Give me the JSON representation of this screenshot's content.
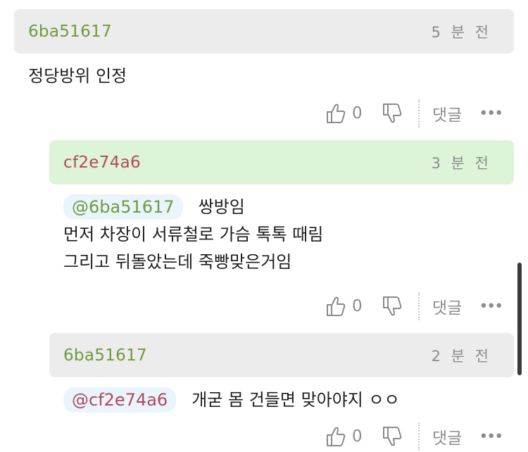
{
  "comments": [
    {
      "nickname": "6ba51617",
      "time": "5 분 전",
      "body": "정당방위 인정",
      "likes": "0",
      "reply_label": "댓글"
    },
    {
      "nickname": "cf2e74a6",
      "time": "3 분 전",
      "mention": "@6ba51617",
      "body_lines": [
        "쌍방임",
        "먼저 차장이 서류철로 가슴 톡톡 때림",
        "그리고 뒤돌았는데 죽빵맞은거임"
      ],
      "likes": "0",
      "reply_label": "댓글"
    },
    {
      "nickname": "6ba51617",
      "time": "2 분 전",
      "mention": "@cf2e74a6",
      "body": "개굳 몸 건들면 맞아야지 ㅇㅇ",
      "likes": "0",
      "reply_label": "댓글"
    }
  ],
  "more_label": "•••",
  "colors": {
    "header_gray": "#ececec",
    "header_green": "#ddf4d8",
    "nick_green": "#6e9b40",
    "nick_red": "#b04a5d",
    "mention_blue": "#4a8ecb"
  },
  "icons": [
    "thumbs-up-icon",
    "thumbs-down-icon",
    "more-icon"
  ]
}
